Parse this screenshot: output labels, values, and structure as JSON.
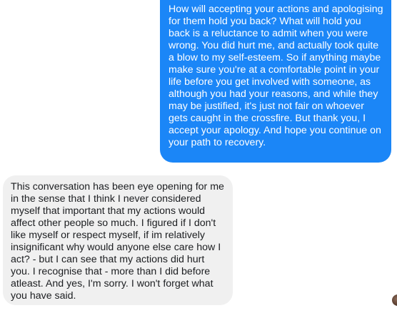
{
  "conversation": {
    "messages": [
      {
        "direction": "sent",
        "text": "How will accepting your actions and apologising for them hold you back? What will hold you back is a reluctance to admit when you were wrong. You did hurt me, and actually took quite a blow to my self-esteem. So if anything maybe make sure you're at a comfortable point in your life before you get involved with someone, as although you had your reasons, and while they may be justified, it's just not fair on whoever gets caught in the crossfire. But thank you, I accept your apology. And hope you continue on your path to recovery."
      },
      {
        "direction": "received",
        "text": "This conversation has been eye opening for me in the sense that I think I never considered myself that important that my actions would affect other people so much. I figured if I don't like myself or respect myself, if im relatively insignificant why would anyone else care how I act? - but I can see that my actions did hurt you. I recognise that - more than I did before atleast. And yes, I'm sorry. I won't forget what you have said."
      }
    ]
  },
  "colors": {
    "sent_bubble": "#1b86f7",
    "received_bubble": "#f0f0f0",
    "received_text": "#1c1e21"
  }
}
